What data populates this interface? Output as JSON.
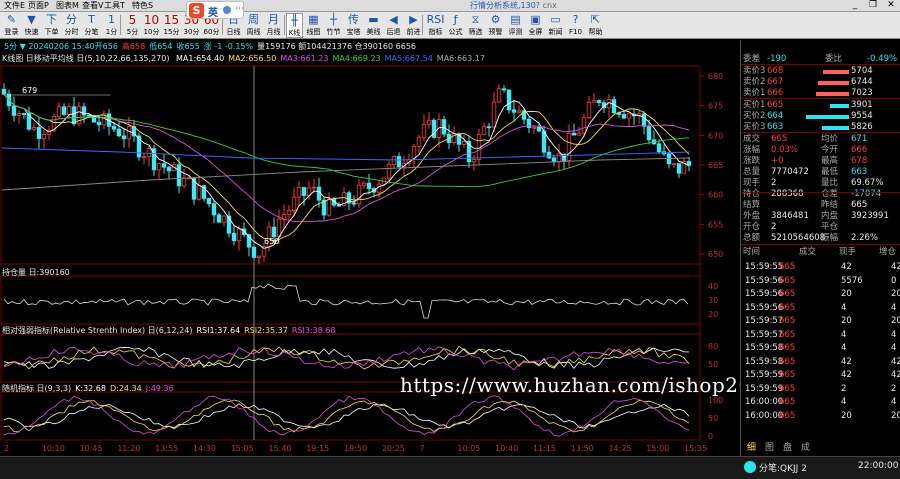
{
  "menu": [
    "文件E",
    "页面P",
    "图表M",
    "查看V",
    "工具T",
    "特色S"
  ],
  "app_title": "行情分析系统,130?",
  "app_title_suffix": "cnx",
  "ime": {
    "logo": "S",
    "mode": "英",
    "more": "⋯"
  },
  "toolbar": [
    {
      "icon": "✎",
      "label": "登录"
    },
    {
      "icon": "▼",
      "label": "快速"
    },
    {
      "icon": "下",
      "label": "下单"
    },
    {
      "icon": "分",
      "label": "分时"
    },
    {
      "icon": "T",
      "label": "分笔"
    },
    {
      "icon": "1",
      "label": "1分"
    },
    {
      "icon": "5",
      "label": "5分",
      "per": true
    },
    {
      "icon": "10",
      "label": "10分",
      "per": true
    },
    {
      "icon": "15",
      "label": "15分",
      "per": true
    },
    {
      "icon": "30",
      "label": "30分",
      "per": true
    },
    {
      "icon": "60",
      "label": "60分",
      "per": true
    },
    {
      "icon": "日",
      "label": "日线"
    },
    {
      "icon": "周",
      "label": "周线"
    },
    {
      "icon": "月",
      "label": "月线"
    },
    {
      "icon": "╫",
      "label": "K线",
      "sel": true
    },
    {
      "icon": "▦",
      "label": "线图"
    },
    {
      "icon": "┼",
      "label": "竹节"
    },
    {
      "icon": "传",
      "label": "宝塔"
    },
    {
      "icon": "▬",
      "label": "美线"
    },
    {
      "icon": "◀",
      "label": "后退"
    },
    {
      "icon": "▶",
      "label": "前进"
    },
    {
      "icon": "RSI",
      "label": "指标"
    },
    {
      "icon": "ƒ",
      "label": "公式"
    },
    {
      "icon": "⧖",
      "label": "筛选"
    },
    {
      "icon": "⚙",
      "label": "预警"
    },
    {
      "icon": "▤",
      "label": "评测"
    },
    {
      "icon": "▣",
      "label": "全屏"
    },
    {
      "icon": "▭",
      "label": "新闻"
    },
    {
      "icon": "?",
      "label": "F10"
    },
    {
      "icon": "⇱",
      "label": "帮助"
    }
  ],
  "window_controls": [
    "_",
    "❐",
    "✕"
  ],
  "chart": {
    "info": "5分 ▼ 20240206 15:40开656 高658 低654 收655 涨 -1 -0.15% 量159176 额104421376 仓390160 6656",
    "info_main": "5分 ▼ 20240206 15:40开656",
    "info_high": "高658",
    "info_low": "低654",
    "info_close": "收655",
    "info_chg": "涨 -1 -0.15%",
    "info_rest": "量159176 额104421376 仓390160 6656",
    "ma_name": "K线图 日移动平均线 日(5,10,22,66,135,270)",
    "ma_vals": [
      {
        "text": "MA1:654.40",
        "color": "#ffffff"
      },
      {
        "text": "MA2:656.50",
        "color": "#ffe040"
      },
      {
        "text": "MA3:661.23",
        "color": "#e050e0"
      },
      {
        "text": "MA4:669.23",
        "color": "#36d03a"
      },
      {
        "text": "MA5:667.54",
        "color": "#3a6cff"
      },
      {
        "text": "MA6:663.17",
        "color": "#aaaaaa"
      }
    ],
    "price_ticks": [
      "680",
      "675",
      "670",
      "665",
      "660",
      "655",
      "650"
    ],
    "marker_high": "679",
    "marker_low": "650",
    "oi_label": "持仓量 日:390160",
    "oi_ticks": [
      "40",
      "30",
      "20"
    ],
    "rsi_label": "相对强弱指标(Relative Strenth Index) 日(6,12,24)",
    "rsi_vals": [
      {
        "text": "RSI1:37.64",
        "color": "#ffffff"
      },
      {
        "text": "RSI2:35.37",
        "color": "#ffe040"
      },
      {
        "text": "RSI3:38.68",
        "color": "#e050e0"
      }
    ],
    "rsi_ticks": [
      "80",
      "50"
    ],
    "kdj_label": "随机指标 日(9,3,3)",
    "kdj_vals": [
      {
        "text": "K:32.68",
        "color": "#ffffff"
      },
      {
        "text": "D:24.34",
        "color": "#ffe040"
      },
      {
        "text": "J:49.36",
        "color": "#e050e0"
      }
    ],
    "kdj_ticks": [
      "100",
      "50",
      "0"
    ],
    "time_ticks": [
      "2",
      "10:10",
      "10:45",
      "11:20",
      "13:55",
      "14:30",
      "15:05",
      "15:40",
      "19:15",
      "19:50",
      "20:25",
      "7",
      "10:05",
      "10:40",
      "11:15",
      "13:50",
      "14:25",
      "15:00",
      "15:35"
    ]
  },
  "stats": {
    "weibi": {
      "k1": "委差",
      "v1": "-190",
      "k2": "委比",
      "v2": "-0.49%"
    },
    "asks": [
      {
        "k": "卖价3",
        "p": "668",
        "v": "5704"
      },
      {
        "k": "卖价2",
        "p": "667",
        "v": "6744"
      },
      {
        "k": "卖价1",
        "p": "666",
        "v": "7023"
      }
    ],
    "bids": [
      {
        "k": "买价1",
        "p": "665",
        "v": "3901"
      },
      {
        "k": "买价2",
        "p": "664",
        "v": "9554"
      },
      {
        "k": "买价3",
        "p": "663",
        "v": "5826"
      }
    ],
    "detail": [
      {
        "k": "成交",
        "v": "665",
        "k2": "均价",
        "v2": "671",
        "c1": "red",
        "c2": "cyn"
      },
      {
        "k": "涨幅",
        "v": "0.03%",
        "k2": "今开",
        "v2": "666",
        "c1": "red",
        "c2": "red"
      },
      {
        "k": "涨跌",
        "v": "+0",
        "k2": "最高",
        "v2": "678",
        "c1": "red",
        "c2": "red"
      },
      {
        "k": "总量",
        "v": "7770472",
        "k2": "最低",
        "v2": "663",
        "c1": "wht",
        "c2": "cyn"
      },
      {
        "k": "现手",
        "v": "2",
        "k2": "量比",
        "v2": "69.67%",
        "c1": "wht",
        "c2": "wht"
      },
      {
        "k": "持仓",
        "v": "288368",
        "k2": "仓差",
        "v2": "-17074",
        "c1": "wht",
        "c2": "cyn"
      },
      {
        "k": "结算",
        "v": "",
        "k2": "昨结",
        "v2": "665",
        "c1": "wht",
        "c2": "wht"
      },
      {
        "k": "外盘",
        "v": "3846481",
        "k2": "内盘",
        "v2": "3923991",
        "c1": "wht",
        "c2": "wht"
      },
      {
        "k": "开仓",
        "v": "2",
        "k2": "平仓",
        "v2": "",
        "c1": "wht",
        "c2": "wht"
      },
      {
        "k": "总额",
        "v": "5210564608",
        "k2": "振幅",
        "v2": "2.26%",
        "c1": "wht",
        "c2": "wht"
      }
    ],
    "ticks_header": [
      "时间",
      "成交",
      "现手",
      "增仓"
    ],
    "ticks": [
      {
        "t": "15:59:55",
        "p": "665",
        "v": "42",
        "d": "42"
      },
      {
        "t": "15:59:56",
        "p": "665",
        "v": "5576",
        "d": "0"
      },
      {
        "t": "15:59:56",
        "p": "665",
        "v": "20",
        "d": "20"
      },
      {
        "t": "15:59:56",
        "p": "665",
        "v": "4",
        "d": "4"
      },
      {
        "t": "15:59:57",
        "p": "665",
        "v": "20",
        "d": "20"
      },
      {
        "t": "15:59:57",
        "p": "665",
        "v": "4",
        "d": "4"
      },
      {
        "t": "15:59:58",
        "p": "665",
        "v": "4",
        "d": "4"
      },
      {
        "t": "15:59:58",
        "p": "665",
        "v": "42",
        "d": "42"
      },
      {
        "t": "15:59:59",
        "p": "665",
        "v": "42",
        "d": "42"
      },
      {
        "t": "15:59:59",
        "p": "665",
        "v": "2",
        "d": "2"
      },
      {
        "t": "16:00:00",
        "p": "665",
        "v": "4",
        "d": "4"
      },
      {
        "t": "16:00:00",
        "p": "665",
        "v": "20",
        "d": "20"
      }
    ],
    "tabs": [
      "细",
      "图",
      "盘",
      "成"
    ]
  },
  "status": {
    "code": "分笔:QKJJ 2",
    "time": "22:00:00"
  },
  "watermark": "https://www.huzhan.com/ishop20823"
}
